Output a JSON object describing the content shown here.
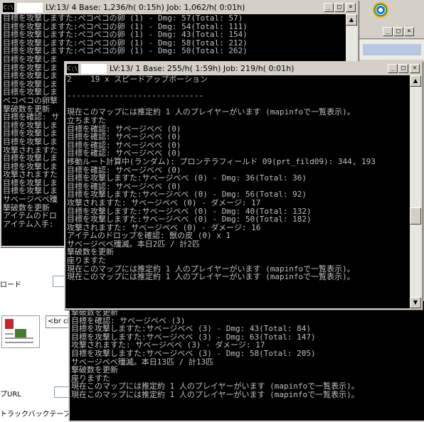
{
  "background": {
    "form_labels": [
      "ロード",
      "プURL",
      "トラックバックテーブ"
    ],
    "tooltip": "<br cle",
    "colors": {
      "panel": "#d4d0c8",
      "page": "#ffffff"
    }
  },
  "window1": {
    "title": "LV:13/ 4  Base:    1,236/h( 0:15h)  Job:    1,062/h( 0:01h)",
    "lines": [
      "目標を攻撃しますた:ペコペコの卵 (1) - Dmg: 57(Total: 57)",
      "目標を攻撃しますた:ペコペコの卵 (1) - Dmg: 54(Total: 111)",
      "目標を攻撃しますた:ペコペコの卵 (1) - Dmg: 43(Total: 154)",
      "目標を攻撃しますた:ペコペコの卵 (1) - Dmg: 58(Total: 212)",
      "目標を攻撃しますた:ペコペコの卵 (1) - Dmg: 50(Total: 262)",
      "目標を攻撃しま",
      "目標を攻撃しま",
      "目標を攻撃しま",
      "目標を攻撃しま",
      "目標を攻撃しま",
      "ペコペコの卵撃",
      "撃破数を更新",
      "目標を確認: サ",
      "目標を攻撃しま",
      "目標を攻撃しま",
      "目標を攻撃しま",
      "攻撃されますた",
      "目標を攻撃しま",
      "目標を攻撃しま",
      "攻撃されますた",
      "目標を攻撃しま",
      "目標を攻撃しま",
      "サベージベベ殲",
      "撃破数を更新",
      "アイテムのドロ",
      "アイテム入手:"
    ]
  },
  "window2": {
    "title": "LV:13/ 1  Base:     255/h( 1:59h)  Job:     219/h( 0:01h)",
    "lines": [
      "2    19 x スピードアップポーション",
      "",
      "-----------------------------",
      "",
      "現在このマップには推定約 1 人のプレイヤーがいます (mapinfoで一覧表示)。",
      "立ちますた",
      "目標を確認: サベージベベ (0)",
      "目標を確認: サベージベベ (0)",
      "目標を確認: サベージベベ (0)",
      "目標を確認: サベージベベ (0)",
      "移動ルート計算中(ランダム): プロンテラフィールド 09(prt_fild09): 344, 193",
      "目標を確認: サベージベベ (0)",
      "目標を攻撃しますた:サベージベベ (0) - Dmg: 36(Total: 36)",
      "目標を確認: サベージベベ (0)",
      "目標を攻撃しますた:サベージベベ (0) - Dmg: 56(Total: 92)",
      "攻撃されますた: サベージベベ (0) - ダメージ: 17",
      "目標を攻撃しますた:サベージベベ (0) - Dmg: 40(Total: 132)",
      "目標を攻撃しますた:サベージベベ (0) - Dmg: 50(Total: 182)",
      "攻撃されますた: サベージベベ (0) - ダメージ: 16",
      "アイテムのドロップを確認: 獣の皮 (0) x 1",
      "サベージベベ殲滅。本日2匹 / 計2匹",
      "撃破数を更新",
      "座りますた",
      "現在このマップには推定約 1 人のプレイヤーがいます (mapinfoで一覧表示)。",
      "現在このマップには推定約 1 人のプレイヤーがいます (mapinfoで一覧表示)。"
    ]
  },
  "window3": {
    "lines": [
      "撃破数を更新",
      "目標を確認: サベージベベ (3)",
      "目標を攻撃しますた:サベージベベ (3) - Dmg: 43(Total: 84)",
      "目標を攻撃しますた:サベージベベ (3) - Dmg: 63(Total: 147)",
      "攻撃されますた: サベージベベ (3) - ダメージ: 17",
      "目標を攻撃しますた:サベージベベ (3) - Dmg: 58(Total: 205)",
      "サベージベベ殲滅。本日13匹 / 計13匹",
      "撃破数を更新",
      "座りますた",
      "現在このマップには推定約 1 人のプレイヤーがいます (mapinfoで一覧表示)。",
      "現在このマップには推定約 1 人のプレイヤーがいます (mapinfoで一覧表示)。"
    ]
  },
  "controls": {
    "minimize": "_",
    "maximize": "□",
    "close": "×",
    "up": "▲",
    "down": "▼",
    "cmd_icon": "C:\\"
  },
  "colors": {
    "console_bg": "#000000",
    "console_text": "#c0c0c0",
    "frame": "#d4d0c8"
  }
}
